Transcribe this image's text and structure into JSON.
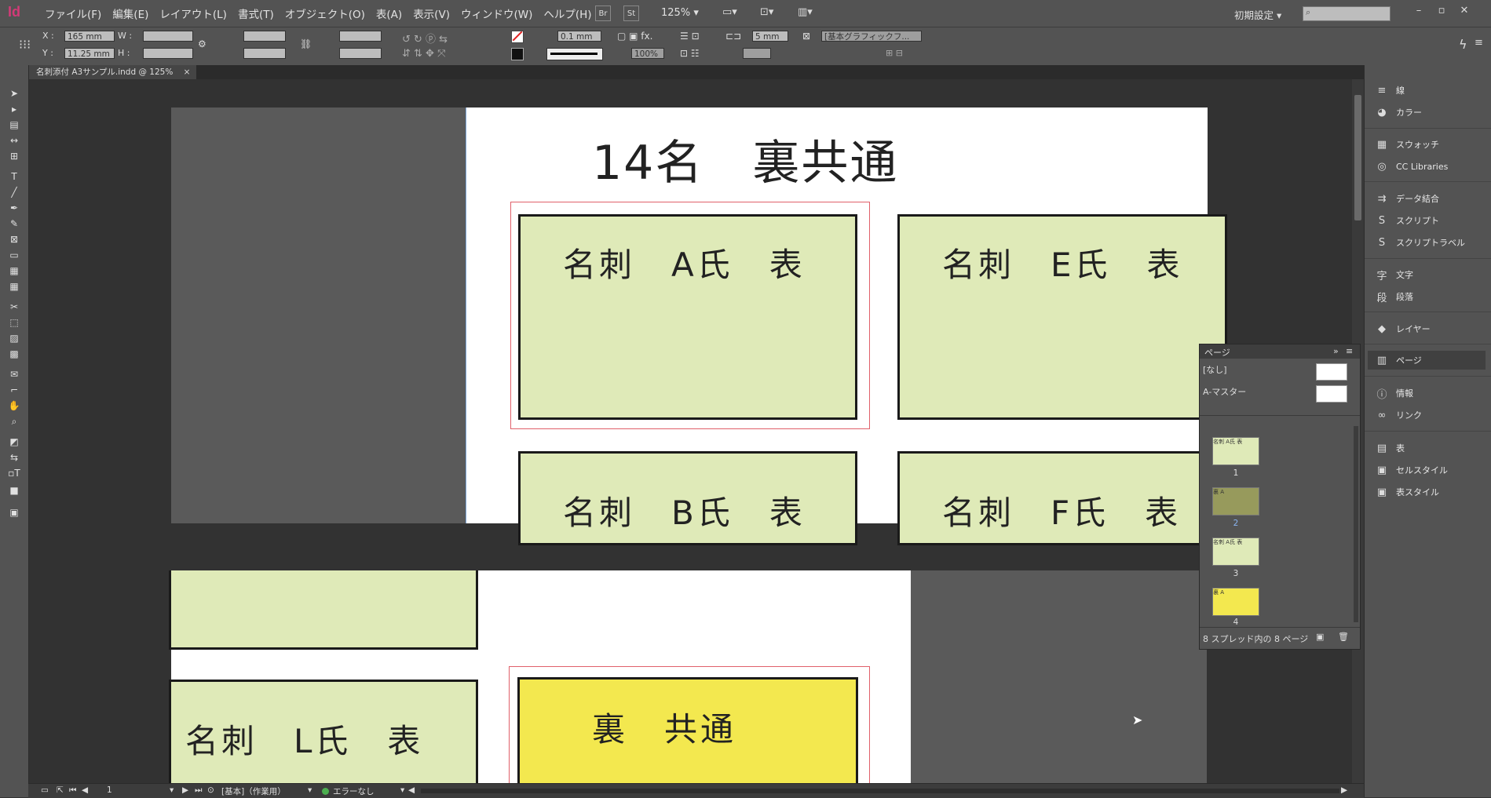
{
  "app": {
    "logo": "Id"
  },
  "menu": [
    "ファイル(F)",
    "編集(E)",
    "レイアウト(L)",
    "書式(T)",
    "オブジェクト(O)",
    "表(A)",
    "表示(V)",
    "ウィンドウ(W)",
    "ヘルプ(H)"
  ],
  "menubar": {
    "bridge_button": "Br",
    "stock_button": "St",
    "zoom": "125%",
    "workspace": "初期設定"
  },
  "control": {
    "x_label": "X :",
    "x_value": "165 mm",
    "y_label": "Y :",
    "y_value": "11.25 mm",
    "w_label": "W :",
    "h_label": "H :",
    "stroke_weight": "0.1 mm",
    "scale_value": "100%",
    "offset_value": "5 mm",
    "object_style": "[基本グラフィックフ..."
  },
  "tab": {
    "title": "名刺添付 A3サンプル.indd @ 125%",
    "close": "×"
  },
  "spread1": {
    "heading": "14名　裏共通",
    "cards": [
      "名刺　A氏　表",
      "名刺　E氏　表",
      "名刺　B氏　表",
      "名刺　F氏　表"
    ]
  },
  "spread2": {
    "cards": [
      "名刺　L氏　表",
      "裏　共通"
    ]
  },
  "pages_panel": {
    "title": "ページ",
    "masters": [
      "[なし]",
      "A-マスター"
    ],
    "pages": [
      {
        "num": "1",
        "color": "#dfeab8",
        "label": "名刺 A氏 表"
      },
      {
        "num": "2",
        "color": "#979a5c",
        "label": "裏 A"
      },
      {
        "num": "3",
        "color": "#dfeab8",
        "label": "名刺 A氏 表"
      },
      {
        "num": "4",
        "color": "#f3e84f",
        "label": "裏 A"
      }
    ],
    "footer": "8 スプレッド内の 8 ページ"
  },
  "dock": [
    {
      "icon": "stroke-icon",
      "glyph": "≡",
      "label": "線"
    },
    {
      "icon": "color-icon",
      "glyph": "◕",
      "label": "カラー"
    },
    {
      "icon": "swatches-icon",
      "glyph": "▦",
      "label": "スウォッチ"
    },
    {
      "icon": "cc-libraries-icon",
      "glyph": "◎",
      "label": "CC Libraries"
    },
    {
      "icon": "data-merge-icon",
      "glyph": "⇉",
      "label": "データ結合"
    },
    {
      "icon": "scripts-icon",
      "glyph": "S",
      "label": "スクリプト"
    },
    {
      "icon": "script-label-icon",
      "glyph": "S",
      "label": "スクリプトラベル"
    },
    {
      "icon": "character-icon",
      "glyph": "字",
      "label": "文字"
    },
    {
      "icon": "paragraph-icon",
      "glyph": "段",
      "label": "段落"
    },
    {
      "icon": "layers-icon",
      "glyph": "◆",
      "label": "レイヤー"
    },
    {
      "icon": "pages-icon",
      "glyph": "▥",
      "label": "ページ"
    },
    {
      "icon": "info-icon",
      "glyph": "ⓘ",
      "label": "情報"
    },
    {
      "icon": "links-icon",
      "glyph": "∞",
      "label": "リンク"
    },
    {
      "icon": "table-icon",
      "glyph": "▤",
      "label": "表"
    },
    {
      "icon": "cell-styles-icon",
      "glyph": "▣",
      "label": "セルスタイル"
    },
    {
      "icon": "table-styles-icon",
      "glyph": "▣",
      "label": "表スタイル"
    }
  ],
  "status": {
    "page": "1",
    "master": "[基本]（作業用）",
    "preflight": "エラーなし"
  }
}
